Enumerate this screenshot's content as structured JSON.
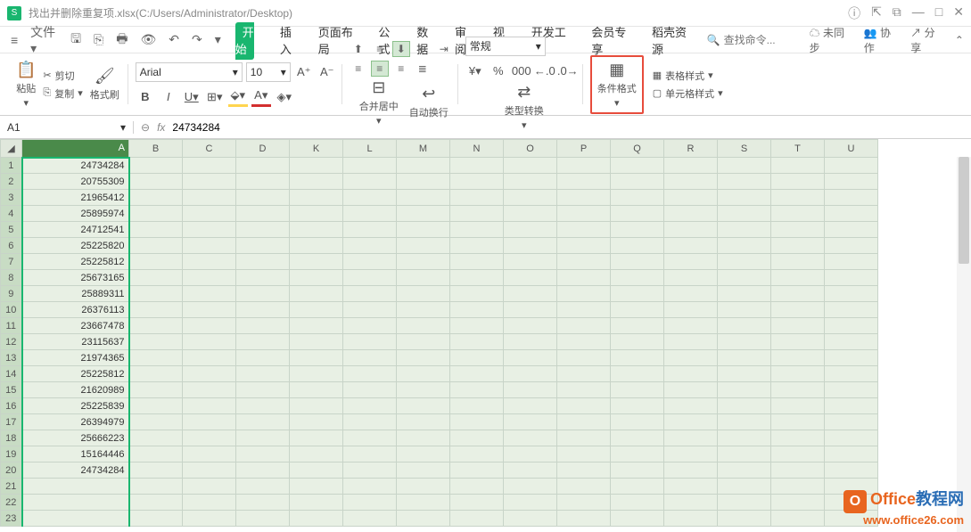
{
  "titlebar": {
    "logo": "S",
    "filename": "找出并删除重复项.xlsx(C:/Users/Administrator/Desktop)"
  },
  "menu": {
    "file": "文件",
    "tabs": [
      "开始",
      "插入",
      "页面布局",
      "公式",
      "数据",
      "审阅",
      "视图",
      "开发工具",
      "会员专享",
      "稻壳资源"
    ],
    "active_tab": 0,
    "search_placeholder": "查找命令...",
    "sync": "未同步",
    "coop": "协作",
    "share": "分享"
  },
  "ribbon": {
    "paste": "粘贴",
    "cut": "剪切",
    "copy": "复制",
    "format_painter": "格式刷",
    "font_name": "Arial",
    "font_size": "10",
    "merge_center": "合并居中",
    "auto_wrap": "自动换行",
    "number_format": "常规",
    "type_convert": "类型转换",
    "cond_format": "条件格式",
    "table_style": "表格样式",
    "cell_style": "单元格样式"
  },
  "formula": {
    "name_box": "A1",
    "value": "24734284"
  },
  "sheet": {
    "columns": [
      "A",
      "B",
      "C",
      "D",
      "K",
      "L",
      "M",
      "N",
      "O",
      "P",
      "Q",
      "R",
      "S",
      "T",
      "U"
    ],
    "col_a_values": [
      "24734284",
      "20755309",
      "21965412",
      "25895974",
      "24712541",
      "25225820",
      "25225812",
      "25673165",
      "25889311",
      "26376113",
      "23667478",
      "23115637",
      "21974365",
      "25225812",
      "21620989",
      "25225839",
      "26394979",
      "25666223",
      "15164446",
      "24734284",
      "",
      "",
      ""
    ],
    "row_count": 23
  },
  "watermark": {
    "line1_a": "Office",
    "line1_b": "教程网",
    "line2": "www.office26.com"
  }
}
